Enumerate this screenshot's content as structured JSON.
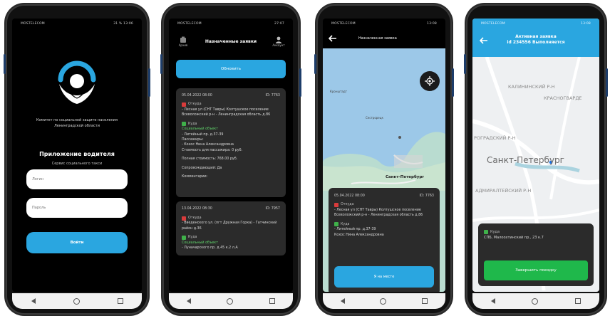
{
  "status": {
    "carrier": "MOSTELECOM",
    "p1_right": "31 % 13:06",
    "p2_right": "27:07",
    "p3_right": "13:08",
    "p4_right": "13:08"
  },
  "phone1": {
    "org": "Комитет по социальной защите населения Ленинградской области",
    "app_title": "Приложение водителя",
    "app_subtitle": "Сервис социального такси",
    "login_placeholder": "Логин",
    "password_placeholder": "Пароль",
    "login_button": "Войти"
  },
  "phone2": {
    "archive_label": "Архив",
    "title": "Назначенные заявки",
    "account_label": "Аккаунт",
    "refresh_button": "Обновить",
    "cards": [
      {
        "date": "05.04.2022 08:00",
        "id": "ID: 7763",
        "from_label": "Откуда",
        "from": "- Лесная ул (СНТ Тавры) Колтушское поселение Всеволожский р-н - Ленинградская область д.86",
        "to_label": "Куда",
        "to_title": "Социальный объект",
        "to": "- Литейный пр. д.37-39",
        "passengers_label": "Пассажиры:",
        "passenger": "- Кохос Нина Александровна",
        "passenger_cost": "Стоимость для пассажира: 0 руб.",
        "full_cost": "Полная стоимость: 768.00 руб.",
        "escort": "Сопровождающий: Да",
        "comments": "Комментарии:"
      },
      {
        "date": "13.04.2022 08:30",
        "id": "ID: 7957",
        "from_label": "Откуда",
        "from": "- Введенского ул. (пгт Дружная Горка) - Гатчинский район д.36",
        "to_label": "Куда",
        "to_title": "Социальный объект",
        "to": "- Луначарского пр. д.45 к.2 л.А"
      }
    ]
  },
  "phone3": {
    "title": "Назначенная заявка",
    "map_city": "Санкт-Петербург",
    "map_labels": [
      "Кронштадт",
      "Сестрорецк",
      "Гатчина"
    ],
    "card": {
      "date": "05.04.2022 08:00",
      "id": "ID: 7763",
      "from_label": "Откуда",
      "from": "- Лесная ул (СНТ Тавры) Колтушское поселение Всеволожский р-н - Ленинградская область д.86",
      "to_label": "Куда",
      "to": "- Литейный пр. д.37-39",
      "passenger": "Кохос Нина Александровна"
    },
    "arrived_button": "Я на месте"
  },
  "phone4": {
    "title_line1": "Активная заявка",
    "title_line2": "id 234556 Выполняется",
    "districts": [
      "КАЛИНИНСКИЙ Р-Н",
      "КРАСНОГВАРДЕ",
      "РОГРАДСКИЙ Р-Н",
      "Санкт-Петербург",
      "АДМИРАЛТЕЙСКИЙ Р-Н"
    ],
    "to_label": "Куда",
    "to": "СПБ, Малоохтинский пр., 23 к.7",
    "finish_button": "Завершить поездку"
  },
  "colors": {
    "accent": "#2aa6e0",
    "success": "#1fb84b",
    "card_bg": "#2b2b2b"
  }
}
